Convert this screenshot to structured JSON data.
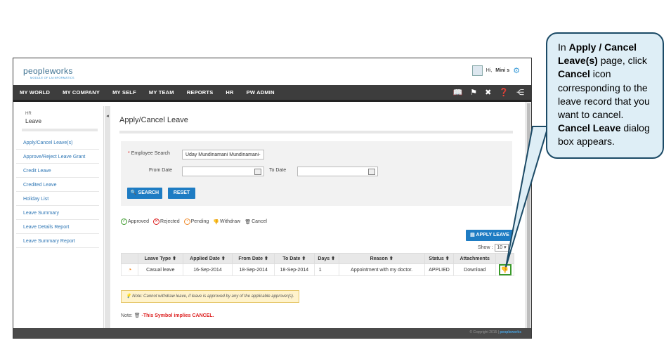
{
  "header": {
    "logo_text": "peopleworks",
    "logo_tagline": "MODULE OF LA INFORMATICS",
    "user_greeting": "Hi,",
    "user_name": "Mini s"
  },
  "nav": {
    "items": [
      "MY WORLD",
      "MY COMPANY",
      "MY SELF",
      "MY TEAM",
      "REPORTS",
      "HR",
      "PW ADMIN"
    ],
    "icons": [
      "book-icon",
      "flag-icon",
      "tools-icon",
      "help-icon",
      "sitemap-icon"
    ]
  },
  "sidebar": {
    "section": "HR",
    "title": "Leave",
    "items": [
      "Apply/Cancel Leave(s)",
      "Approve/Reject Leave Grant",
      "Credit Leave",
      "Credited Leave",
      "Holiday List",
      "Leave Summary",
      "Leave Details Report",
      "Leave Summary Report"
    ]
  },
  "main": {
    "title": "Apply/Cancel Leave",
    "search": {
      "employee_label": "Employee Search",
      "employee_value": "Uday Mundinamani Mundinamani-",
      "from_label": "From Date",
      "to_label": "To Date",
      "search_btn": "SEARCH",
      "reset_btn": "RESET"
    },
    "legend": {
      "approved": "Approved",
      "rejected": "Rejected",
      "pending": "Pending",
      "withdraw": "Withdraw",
      "cancel": "Cancel"
    },
    "apply_btn": "APPLY LEAVE",
    "show_label": "Show :",
    "show_value": "10",
    "table": {
      "headers": [
        "Leave Type",
        "Applied Date",
        "From Date",
        "To Date",
        "Days",
        "Reason",
        "Status",
        "Attachments"
      ],
      "rows": [
        {
          "leave_type": "Casual leave",
          "applied": "16-Sep-2014",
          "from": "18-Sep-2014",
          "to": "18-Sep-2014",
          "days": "1",
          "reason": "Appointment with my doctor.",
          "status": "APPLIED",
          "attachments": "Download"
        }
      ]
    },
    "note1": "Note: Cannot withdraw leave, if leave is approved by any of the applicable approver(s).",
    "note2_prefix": "Note:",
    "note2_text": "-This Symbol implies CANCEL."
  },
  "footer": {
    "copyright": "© Copyright 2015",
    "brand": "peopleworks"
  },
  "callout": {
    "part1": "In ",
    "bold1": "Apply / Cancel Leave(s)",
    "part2": " page, click ",
    "bold2": "Cancel",
    "part3": " icon corresponding to the leave record that you want to cancel. ",
    "bold3": "Cancel Leave",
    "part4": " dialog box appears."
  },
  "colors": {
    "accent": "#1e7cc3",
    "nav_bg": "#3d3d3d",
    "callout_bg": "#deeef6",
    "highlight": "#3a9a2a"
  }
}
